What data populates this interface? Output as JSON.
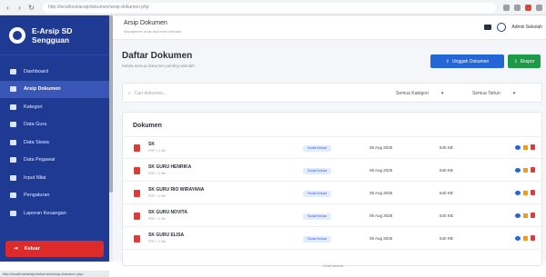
{
  "browser": {
    "url": "http://localhost/arsip/dokumen/arsip-dokumen.php",
    "colors": {
      "bar": "#f1f3f4"
    }
  },
  "sidebar": {
    "brand_line1": "E-Arsip SD",
    "brand_line2": "Sengguan",
    "items": [
      {
        "label": "Dashboard",
        "icon": "home-icon"
      },
      {
        "label": "Arsip Dokumen",
        "icon": "folder-icon",
        "active": true
      },
      {
        "label": "Kategori",
        "icon": "tag-icon"
      },
      {
        "label": "Data Guru",
        "icon": "user-icon"
      },
      {
        "label": "Data Siswa",
        "icon": "users-icon"
      },
      {
        "label": "Data Pegawai",
        "icon": "briefcase-icon"
      },
      {
        "label": "Input Nilai",
        "icon": "edit-icon"
      },
      {
        "label": "Pengaturan",
        "icon": "gear-icon"
      },
      {
        "label": "Laporan Keuangan",
        "icon": "report-icon"
      }
    ],
    "logout_label": "Keluar",
    "status_url": "http://localhost/arsip/dokumen/arsip-dokumen.php",
    "colors": {
      "bg": "#1e3a93",
      "active": "#3a56b7",
      "logout": "#dd2a2a"
    }
  },
  "topbar": {
    "title": "Arsip Dokumen",
    "subtitle": "Manajemen arsip dokumen sekolah",
    "admin_label": "Admin Sekolah"
  },
  "main": {
    "heading": "Daftar Dokumen",
    "subheading": "Kelola semua dokumen penting sekolah",
    "upload_button": "Unggah Dokumen",
    "download_button": "Ekspor",
    "search_placeholder": "Cari dokumen...",
    "category_select": "Semua Kategori",
    "status_select": "Semua Tahun",
    "card_title": "Dokumen",
    "more_label": "Lihat semua",
    "documents": [
      {
        "name": "SK",
        "sub": "PDF • 1 file",
        "category": "Surat Keluar",
        "date": "05 Aug 2025",
        "size": "540 KB"
      },
      {
        "name": "SK GURU HENRIKA",
        "sub": "PDF • 1 file",
        "category": "Surat Keluar",
        "date": "05 Aug 2025",
        "size": "540 KB"
      },
      {
        "name": "SK GURU RIO WIRAYANA",
        "sub": "PDF • 1 file",
        "category": "Surat Keluar",
        "date": "05 Aug 2025",
        "size": "540 KB"
      },
      {
        "name": "SK GURU NOVITA",
        "sub": "PDF • 1 file",
        "category": "Surat Keluar",
        "date": "05 Aug 2025",
        "size": "540 KB"
      },
      {
        "name": "SK GURU ELISA",
        "sub": "PDF • 1 file",
        "category": "Surat Keluar",
        "date": "05 Aug 2025",
        "size": "540 KB"
      }
    ],
    "colors": {
      "upload": "#2266d8",
      "download": "#1c9a47",
      "pdf": "#e53935"
    }
  }
}
